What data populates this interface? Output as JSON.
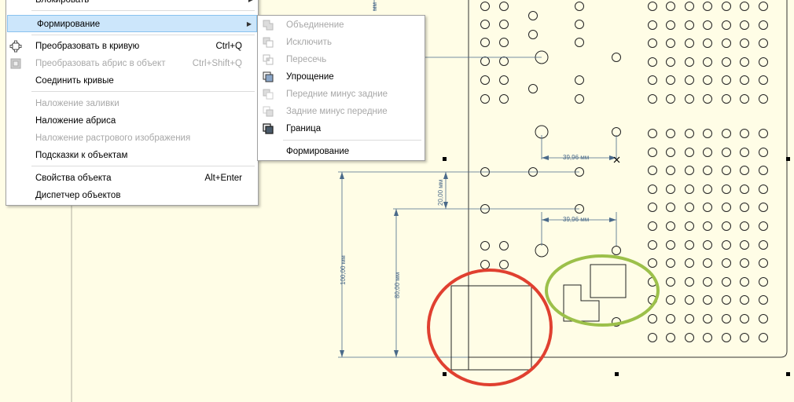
{
  "main_menu": {
    "items": [
      {
        "label": "Блокировать",
        "shortcut": "",
        "disabled": false,
        "submenu": true
      },
      {
        "label": "Формирование",
        "shortcut": "",
        "disabled": false,
        "submenu": true,
        "highlighted": true
      },
      {
        "label": "Преобразовать в кривую",
        "shortcut": "Ctrl+Q",
        "disabled": false,
        "icon": "convert-curve-icon"
      },
      {
        "label": "Преобразовать абрис в объект",
        "shortcut": "Ctrl+Shift+Q",
        "disabled": true,
        "icon": "outline-to-object-icon"
      },
      {
        "label": "Соединить кривые",
        "shortcut": "",
        "disabled": false
      },
      {
        "label": "Наложение заливки",
        "shortcut": "",
        "disabled": true
      },
      {
        "label": "Наложение абриса",
        "shortcut": "",
        "disabled": false
      },
      {
        "label": "Наложение растрового изображения",
        "shortcut": "",
        "disabled": true
      },
      {
        "label": "Подсказки к объектам",
        "shortcut": "",
        "disabled": false
      },
      {
        "label": "Свойства объекта",
        "shortcut": "Alt+Enter",
        "disabled": false
      },
      {
        "label": "Диспетчер объектов",
        "shortcut": "",
        "disabled": false
      }
    ]
  },
  "shaping_submenu": {
    "items": [
      {
        "label": "Объединение",
        "disabled": true,
        "icon": "weld-icon"
      },
      {
        "label": "Исключить",
        "disabled": true,
        "icon": "trim-icon"
      },
      {
        "label": "Пересечь",
        "disabled": true,
        "icon": "intersect-icon"
      },
      {
        "label": "Упрощение",
        "disabled": false,
        "icon": "simplify-icon"
      },
      {
        "label": "Передние минус задние",
        "disabled": true,
        "icon": "front-minus-back-icon"
      },
      {
        "label": "Задние минус передние",
        "disabled": true,
        "icon": "back-minus-front-icon"
      },
      {
        "label": "Граница",
        "disabled": false,
        "icon": "boundary-icon"
      },
      {
        "label": "Формирование",
        "disabled": false
      }
    ]
  },
  "dimensions": {
    "horizontal_top": "39,96 мм",
    "horizontal_mid": "39,96 мм",
    "vertical_small": "20,00 мм",
    "vertical_large": "100,00 мм",
    "vertical_mid": "80,00 мм",
    "top_clipped": "мм"
  },
  "colors": {
    "canvas_bg": "#fffde6",
    "red_marker": "#e04030",
    "green_marker": "#9cc04a",
    "dimension_line": "#4a6a8a",
    "menu_highlight": "#cce6fb"
  }
}
